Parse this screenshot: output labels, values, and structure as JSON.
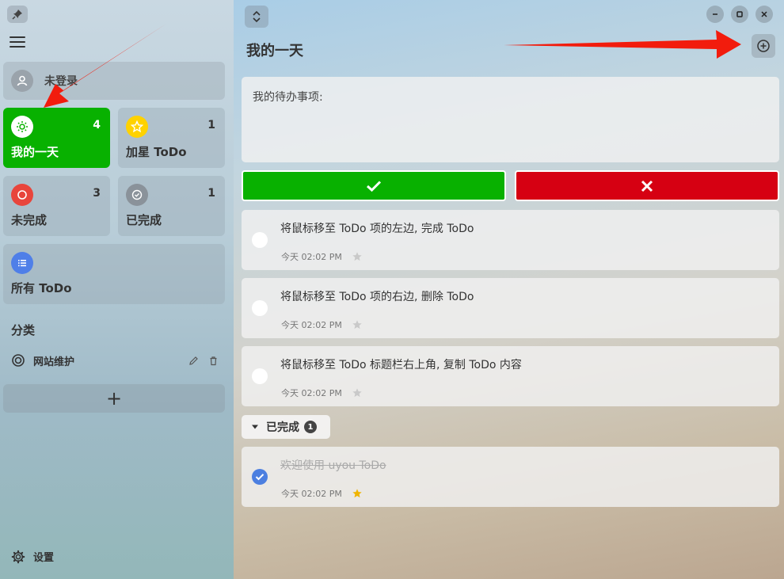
{
  "sidebar": {
    "user_label": "未登录",
    "tiles": [
      {
        "label": "我的一天",
        "count": "4",
        "icon": "sun-icon",
        "color": "#ffffff",
        "active": true
      },
      {
        "label": "加星 ToDo",
        "count": "1",
        "icon": "star-icon",
        "color": "#ffd200"
      },
      {
        "label": "未完成",
        "count": "3",
        "icon": "circle-icon",
        "color": "#e8453c"
      },
      {
        "label": "已完成",
        "count": "1",
        "icon": "check-circle-icon",
        "color": "#8a929a"
      },
      {
        "label": "所有 ToDo",
        "icon": "list-icon",
        "color": "#4f7fe8"
      }
    ],
    "section_title": "分类",
    "categories": [
      {
        "label": "网站维护",
        "icon": "target-icon"
      }
    ],
    "add_category_label": "+",
    "settings_label": "设置"
  },
  "main": {
    "title": "我的一天",
    "input_placeholder": "我的待办事项:",
    "todos": [
      {
        "text": "将鼠标移至 ToDo 项的左边, 完成 ToDo",
        "time": "今天 02:02 PM",
        "starred": false,
        "done": false
      },
      {
        "text": "将鼠标移至 ToDo 项的右边, 删除 ToDo",
        "time": "今天 02:02 PM",
        "starred": false,
        "done": false
      },
      {
        "text": "将鼠标移至 ToDo 标题栏右上角, 复制 ToDo 内容",
        "time": "今天 02:02 PM",
        "starred": false,
        "done": false
      }
    ],
    "completed_label": "已完成",
    "completed_count": "1",
    "completed_todos": [
      {
        "text": "欢迎使用 uyou ToDo",
        "time": "今天 02:02 PM",
        "starred": true,
        "done": true
      }
    ]
  },
  "colors": {
    "active_green": "#08b100",
    "cancel_red": "#d60012",
    "check_blue": "#4c7fe0",
    "arrow_red": "#f21c0d"
  }
}
